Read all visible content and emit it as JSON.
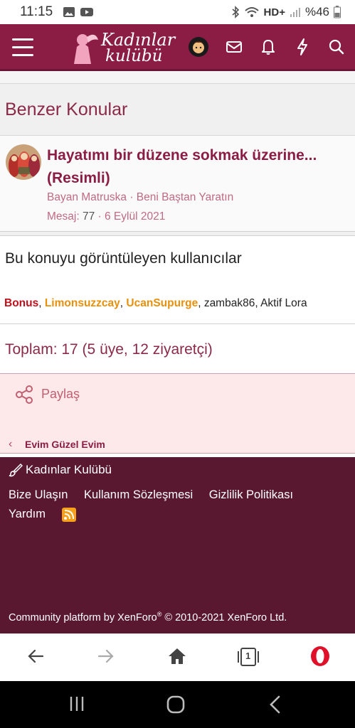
{
  "status_bar": {
    "time": "11:15",
    "network": "HD+",
    "battery": "%46"
  },
  "header": {
    "logo_line1": "Kadınlar",
    "logo_line2": "kulübü"
  },
  "similar": {
    "heading": "Benzer Konular",
    "thread": {
      "title": "Hayatımı bir düzene sokmak üzerine... (Resimli)",
      "author": "Bayan Matruska",
      "forum": "Beni Baştan Yaratın",
      "replies_label": "Mesaj:",
      "replies": "77",
      "date": "6 Eylül 2021"
    }
  },
  "viewers": {
    "heading": "Bu konuyu görüntüleyen kullanıcılar",
    "users": [
      "Bonus",
      "Limonsuzzcay",
      "UcanSupurge",
      "zambak86",
      "Aktif Lora"
    ],
    "total": "Toplam: 17 (5 üye, 12 ziyaretçi)"
  },
  "share": {
    "label": "Paylaş"
  },
  "breadcrumb": {
    "item": "Evim Güzel Evim"
  },
  "footer": {
    "brand": "Kadınlar Kulübü",
    "links": [
      "Bize Ulaşın",
      "Kullanım Sözleşmesi",
      "Gizlilik Politikası",
      "Yardım"
    ],
    "copyright_prefix": "Community platform by XenForo",
    "copyright_mark": "®",
    "copyright_suffix": " © 2010-2021 XenForo Ltd."
  },
  "browser": {
    "tab_count": "1"
  },
  "colors": {
    "brand": "#8b1d45",
    "footer": "#5a1830",
    "share_bg": "#fde8ea",
    "user_red": "#c0101c",
    "user_orange": "#e8900a"
  }
}
